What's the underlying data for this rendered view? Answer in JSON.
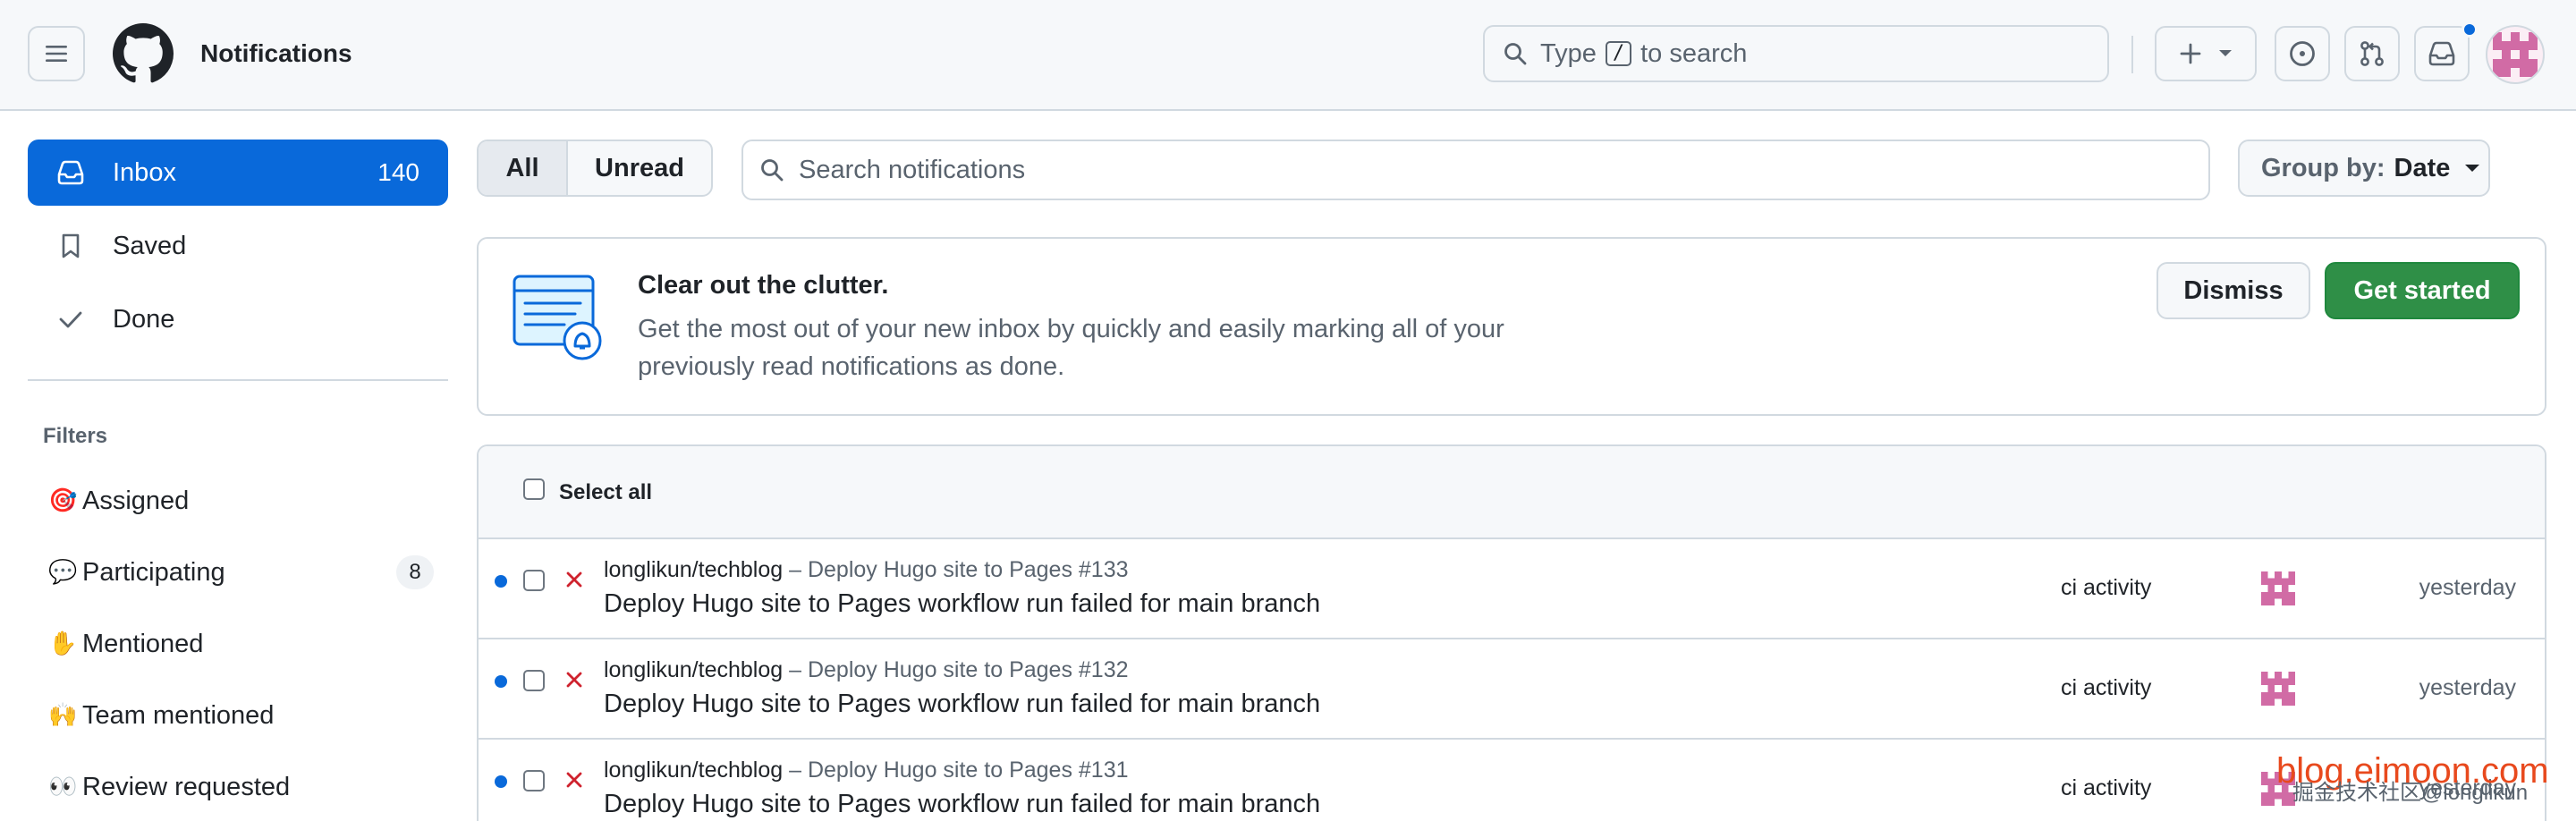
{
  "header": {
    "title": "Notifications",
    "search_prefix": "Type",
    "search_key": "/",
    "search_suffix": "to search"
  },
  "sidebar": {
    "items": [
      {
        "label": "Inbox",
        "count": "140",
        "icon": "inbox-icon",
        "active": true
      },
      {
        "label": "Saved",
        "icon": "bookmark-icon"
      },
      {
        "label": "Done",
        "icon": "check-icon"
      }
    ],
    "filters_title": "Filters",
    "filters": [
      {
        "emoji": "🎯",
        "label": "Assigned"
      },
      {
        "emoji": "💬",
        "label": "Participating",
        "count": "8"
      },
      {
        "emoji": "✋",
        "label": "Mentioned"
      },
      {
        "emoji": "🙌",
        "label": "Team mentioned"
      },
      {
        "emoji": "👀",
        "label": "Review requested"
      }
    ]
  },
  "toolbar": {
    "tab_all": "All",
    "tab_unread": "Unread",
    "search_placeholder": "Search notifications",
    "group_by_label": "Group by:",
    "group_by_value": "Date"
  },
  "banner": {
    "title": "Clear out the clutter.",
    "body": "Get the most out of your new inbox by quickly and easily marking all of your previously read notifications as done.",
    "dismiss": "Dismiss",
    "get_started": "Get started"
  },
  "list": {
    "select_all": "Select all",
    "rows": [
      {
        "repo": "longlikun/techblog",
        "sep": " – ",
        "ref": "Deploy Hugo site to Pages #133",
        "title": "Deploy Hugo site to Pages workflow run failed for main branch",
        "reason": "ci activity",
        "when": "yesterday"
      },
      {
        "repo": "longlikun/techblog",
        "sep": " – ",
        "ref": "Deploy Hugo site to Pages #132",
        "title": "Deploy Hugo site to Pages workflow run failed for main branch",
        "reason": "ci activity",
        "when": "yesterday"
      },
      {
        "repo": "longlikun/techblog",
        "sep": " – ",
        "ref": "Deploy Hugo site to Pages #131",
        "title": "Deploy Hugo site to Pages workflow run failed for main branch",
        "reason": "ci activity",
        "when": "yesterday"
      }
    ]
  },
  "watermark": {
    "text": "blog.eimoon.com",
    "sub": "掘金技术社区@longlikun"
  },
  "colors": {
    "accent": "#0969da",
    "success": "#2f8f47",
    "danger": "#cf222e",
    "border": "#d1d9e0",
    "muted": "#59636e"
  }
}
